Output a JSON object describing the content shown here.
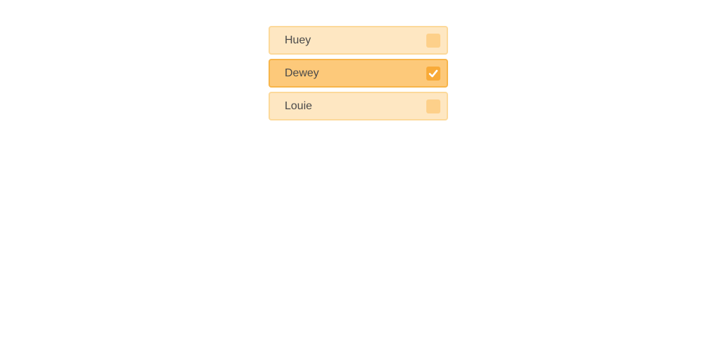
{
  "options": [
    {
      "label": "Huey",
      "checked": false
    },
    {
      "label": "Dewey",
      "checked": true
    },
    {
      "label": "Louie",
      "checked": false
    }
  ]
}
